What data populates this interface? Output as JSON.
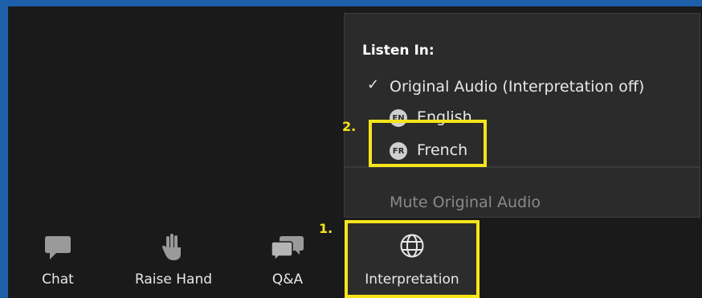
{
  "menu": {
    "title": "Listen In:",
    "items": [
      {
        "label": "Original Audio (Interpretation off)",
        "checked": true
      },
      {
        "label": "English",
        "badge": "EN"
      },
      {
        "label": "French",
        "badge": "FR"
      }
    ],
    "mute_label": "Mute Original Audio"
  },
  "annotations": {
    "step1": "1.",
    "step2": "2."
  },
  "toolbar": {
    "chat": "Chat",
    "raise_hand": "Raise Hand",
    "qa": "Q&A",
    "interpretation": "Interpretation"
  },
  "colors": {
    "frame": "#1d5fa8",
    "background": "#1a1a1a",
    "menu_bg": "#2b2b2b",
    "highlight": "#f5e51a"
  }
}
